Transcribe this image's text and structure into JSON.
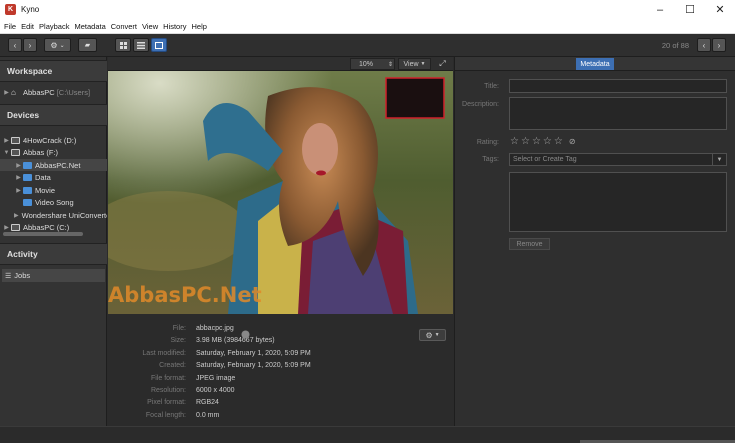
{
  "window": {
    "title": "Kyno",
    "icon_letter": "K",
    "minimize": "–",
    "maximize": "☐",
    "close": "✕"
  },
  "menu": [
    "File",
    "Edit",
    "Playback",
    "Metadata",
    "Convert",
    "View",
    "History",
    "Help"
  ],
  "toolbar": {
    "back": "‹",
    "forward": "›",
    "gear": "⚙",
    "gear_caret": "⌄",
    "folder": "▰",
    "counter": "20 of 88",
    "prev": "‹",
    "next": "›"
  },
  "sidebar": {
    "workspace_title": "Workspace",
    "workspace_item": {
      "name": "AbbasPC",
      "path": "[C:\\Users]"
    },
    "devices_title": "Devices",
    "devices": [
      {
        "label": "4HowCrack (D:)",
        "kind": "drive",
        "depth": 0,
        "arrow": "▶"
      },
      {
        "label": "Abbas (F:)",
        "kind": "drive",
        "depth": 0,
        "arrow": "▼"
      },
      {
        "label": "AbbasPC.Net",
        "kind": "folder",
        "depth": 1,
        "arrow": "▶",
        "selected": true
      },
      {
        "label": "Data",
        "kind": "folder",
        "depth": 1,
        "arrow": "▶"
      },
      {
        "label": "Movie",
        "kind": "folder",
        "depth": 1,
        "arrow": "▶"
      },
      {
        "label": "Video Song",
        "kind": "folder",
        "depth": 1,
        "arrow": ""
      },
      {
        "label": "Wondershare UniConverter",
        "kind": "folder",
        "depth": 1,
        "arrow": "▶"
      },
      {
        "label": "AbbasPC (C:)",
        "kind": "drive",
        "depth": 0,
        "arrow": "▶"
      }
    ],
    "activity_title": "Activity",
    "jobs_label": "Jobs"
  },
  "viewer": {
    "zoom": "10%",
    "view_label": "View",
    "watermark": "AbbasPC.Net"
  },
  "file_info": [
    {
      "key": "File:",
      "value": "abbacpc.jpg"
    },
    {
      "key": "Size:",
      "value": "3.98 MB (3984667 bytes)"
    },
    {
      "key": "Last modified:",
      "value": "Saturday, February 1, 2020, 5:09 PM"
    },
    {
      "key": "Created:",
      "value": "Saturday, February 1, 2020, 5:09 PM"
    },
    {
      "key": "File format:",
      "value": "JPEG image"
    },
    {
      "key": "Resolution:",
      "value": "6000 x 4000"
    },
    {
      "key": "Pixel format:",
      "value": "RGB24"
    },
    {
      "key": "Focal length:",
      "value": "0.0 mm"
    }
  ],
  "metadata": {
    "tab": "Metadata",
    "title_label": "Title:",
    "description_label": "Description:",
    "rating_label": "Rating:",
    "rating_value": 0,
    "rating_max": 5,
    "tags_label": "Tags:",
    "tags_placeholder": "Select or Create Tag",
    "remove_label": "Remove"
  }
}
